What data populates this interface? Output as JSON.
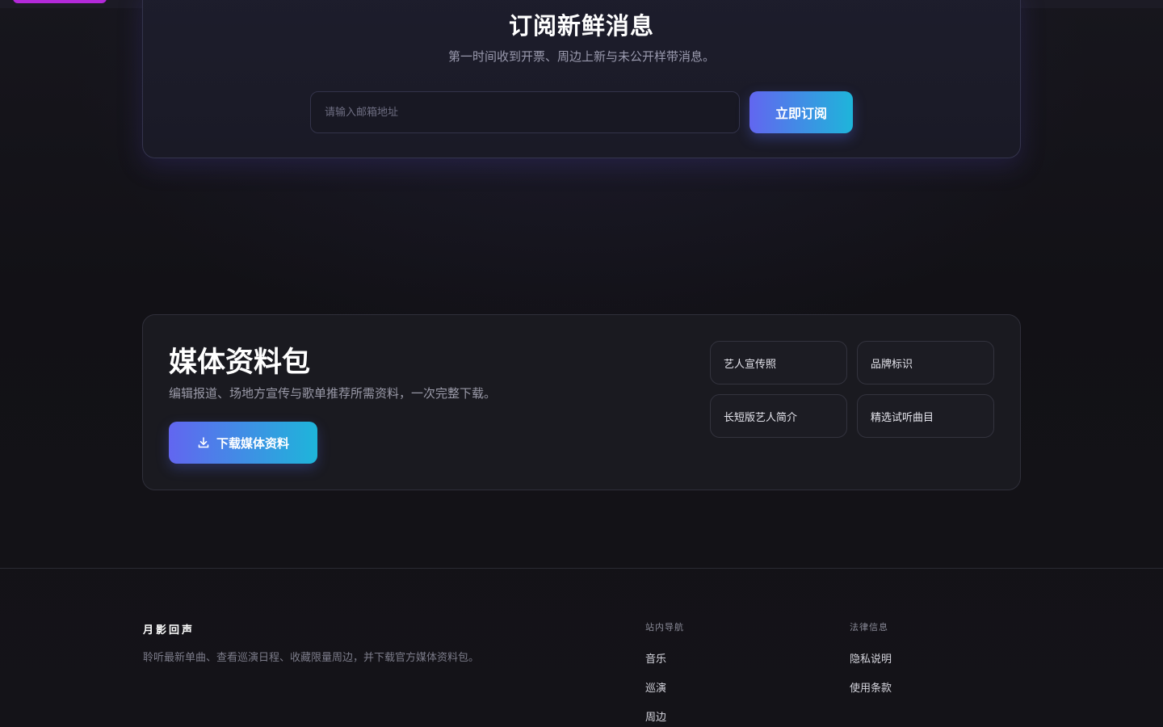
{
  "subscribe": {
    "title": "订阅新鲜消息",
    "subtitle": "第一时间收到开票、周边上新与未公开样带消息。",
    "email_placeholder": "请输入邮箱地址",
    "button_label": "立即订阅"
  },
  "media_kit": {
    "title": "媒体资料包",
    "subtitle": "编辑报道、场地方宣传与歌单推荐所需资料，一次完整下载。",
    "download_label": "下载媒体资料",
    "download_icon": "download-icon",
    "items": [
      "艺人宣传照",
      "品牌标识",
      "长短版艺人简介",
      "精选试听曲目"
    ]
  },
  "footer": {
    "brand": "月影回声",
    "description": "聆听最新单曲、查看巡演日程、收藏限量周边，并下载官方媒体资料包。",
    "nav": {
      "title": "站内导航",
      "links": [
        "音乐",
        "巡演",
        "周边"
      ]
    },
    "legal": {
      "title": "法律信息",
      "links": [
        "隐私说明",
        "使用条款"
      ]
    }
  },
  "colors": {
    "accent_start": "#6266f0",
    "accent_end": "#1eb5da",
    "top_pill": "#b329d9"
  }
}
